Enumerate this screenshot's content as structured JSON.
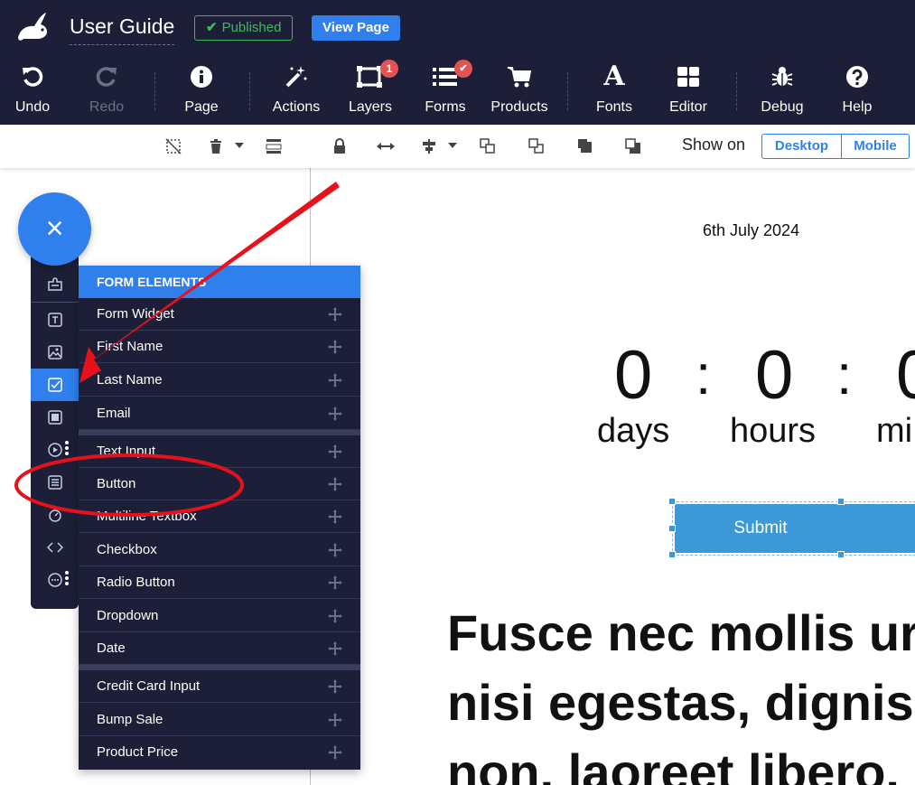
{
  "header": {
    "title": "User Guide",
    "published_label": "Published",
    "view_page_label": "View Page"
  },
  "toolbar": [
    {
      "label": "Undo",
      "icon": "undo-icon"
    },
    {
      "label": "Redo",
      "icon": "redo-icon"
    },
    {
      "label": "Page",
      "icon": "info-icon"
    },
    {
      "label": "Actions",
      "icon": "magic-wand-icon"
    },
    {
      "label": "Layers",
      "icon": "layers-icon",
      "badge": "1"
    },
    {
      "label": "Forms",
      "icon": "forms-icon",
      "badge": "✔"
    },
    {
      "label": "Products",
      "icon": "cart-icon"
    },
    {
      "label": "Fonts",
      "icon": "font-icon"
    },
    {
      "label": "Editor",
      "icon": "grid-icon"
    },
    {
      "label": "Debug",
      "icon": "bug-icon"
    },
    {
      "label": "Help",
      "icon": "help-icon"
    }
  ],
  "subbar": {
    "show_on_label": "Show on",
    "desktop_label": "Desktop",
    "mobile_label": "Mobile"
  },
  "canvas": {
    "date": "6th July 2024",
    "countdown": [
      {
        "value": "0",
        "label": "days"
      },
      {
        "value": "0",
        "label": "hours"
      },
      {
        "value": "0",
        "label": "mi"
      }
    ],
    "separator": ":",
    "submit_label": "Submit",
    "body_lines": [
      "Fusce nec mollis ur",
      "nisi egestas, dignis",
      "non. laoreet libero."
    ]
  },
  "fab": {
    "label": "×"
  },
  "panel": {
    "heading": "FORM ELEMENTS",
    "groups": [
      [
        "Form Widget",
        "First Name",
        "Last Name",
        "Email"
      ],
      [
        "Text Input",
        "Button",
        "Multiline Textbox",
        "Checkbox",
        "Radio Button",
        "Dropdown",
        "Date"
      ],
      [
        "Credit Card Input",
        "Bump Sale",
        "Product Price"
      ]
    ]
  },
  "colors": {
    "topbar": "#1d1f38",
    "accent": "#2f80ed",
    "published": "#3dbb5a",
    "badge": "#e35353",
    "submit": "#3d98d8",
    "annotation": "#e8111b"
  }
}
